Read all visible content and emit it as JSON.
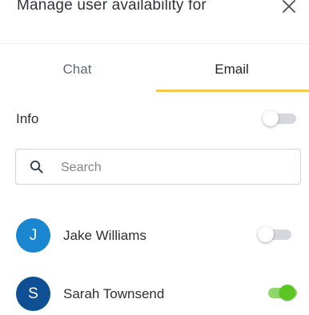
{
  "dialog": {
    "title": "Manage user availability for",
    "close_icon": "close-icon"
  },
  "tabs": [
    {
      "label": "Chat",
      "active": false
    },
    {
      "label": "Email",
      "active": true
    }
  ],
  "colors": {
    "tab_indicator": "#f6c94a",
    "toggle_on": "#59c624",
    "toggle_off": "#d4d7db"
  },
  "info": {
    "label": "Info",
    "toggle_on": false
  },
  "search": {
    "placeholder": "Search",
    "value": "",
    "icon": "search-icon"
  },
  "users": [
    {
      "initial": "J",
      "name": "Jake Williams",
      "avatar_color": "#1a86cf",
      "available": false
    },
    {
      "initial": "S",
      "name": "Sarah Townsend",
      "avatar_color": "#0f4f94",
      "available": true
    }
  ]
}
